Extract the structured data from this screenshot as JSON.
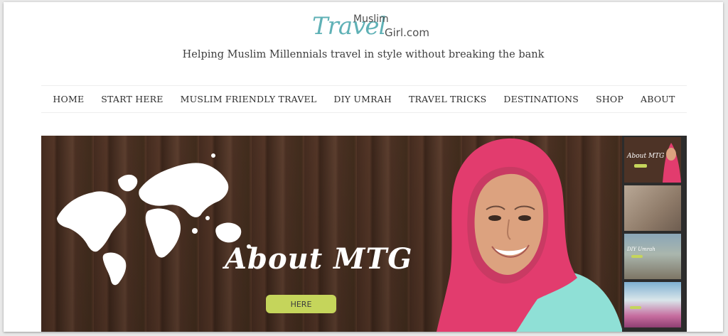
{
  "logo": {
    "script": "Travel",
    "muslim": "Muslim",
    "girl": "Girl.com"
  },
  "tagline": "Helping Muslim Millennials travel in style without breaking the bank",
  "nav": {
    "items": [
      {
        "label": "HOME"
      },
      {
        "label": "START HERE"
      },
      {
        "label": "MUSLIM FRIENDLY TRAVEL"
      },
      {
        "label": "DIY UMRAH"
      },
      {
        "label": "TRAVEL TRICKS"
      },
      {
        "label": "DESTINATIONS"
      },
      {
        "label": "SHOP"
      },
      {
        "label": "ABOUT"
      }
    ]
  },
  "hero": {
    "title": "About MTG",
    "button_label": "HERE"
  },
  "thumbnails": {
    "items": [
      {
        "label": "About MTG"
      },
      {
        "label": ""
      },
      {
        "label": "DIY Umrah"
      },
      {
        "label": ""
      }
    ]
  },
  "colors": {
    "brand_teal": "#5fb1b6",
    "button_green": "#c5d55b",
    "hijab_pink": "#e23c6e",
    "shirt_mint": "#8fe0d6"
  }
}
